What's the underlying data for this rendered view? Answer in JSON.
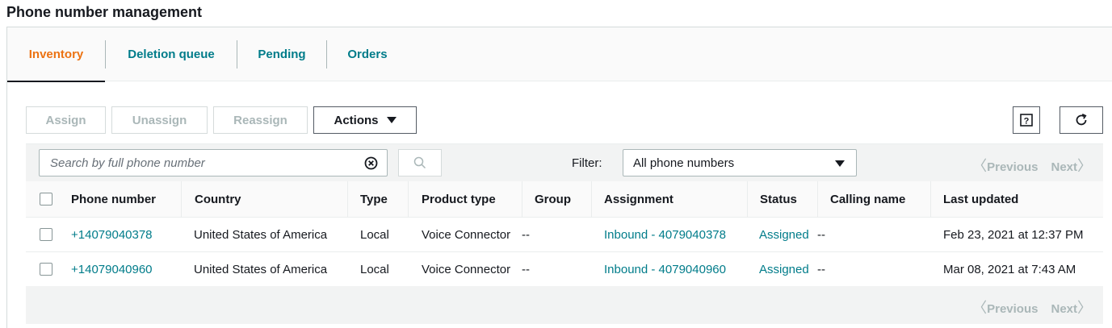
{
  "page": {
    "title": "Phone number management"
  },
  "tabs": [
    {
      "label": "Inventory",
      "active": true
    },
    {
      "label": "Deletion queue"
    },
    {
      "label": "Pending"
    },
    {
      "label": "Orders"
    }
  ],
  "actions": {
    "assign": "Assign",
    "unassign": "Unassign",
    "reassign": "Reassign",
    "actions": "Actions",
    "help_icon": "help-icon",
    "refresh_icon": "refresh-icon"
  },
  "search": {
    "placeholder": "Search by full phone number",
    "value": ""
  },
  "filter": {
    "label": "Filter:",
    "selected": "All phone numbers"
  },
  "pagination": {
    "previous": "Previous",
    "next": "Next"
  },
  "columns": [
    "Phone number",
    "Country",
    "Type",
    "Product type",
    "Group",
    "Assignment",
    "Status",
    "Calling name",
    "Last updated"
  ],
  "rows": [
    {
      "phone": "+14079040378",
      "country": "United States of America",
      "type": "Local",
      "product_type": "Voice Connector",
      "group": "--",
      "assignment": "Inbound - 4079040378",
      "status": "Assigned",
      "calling_name": "--",
      "last_updated": "Feb 23, 2021 at 12:37 PM"
    },
    {
      "phone": "+14079040960",
      "country": "United States of America",
      "type": "Local",
      "product_type": "Voice Connector",
      "group": "--",
      "assignment": "Inbound - 4079040960",
      "status": "Assigned",
      "calling_name": "--",
      "last_updated": "Mar 08, 2021 at 7:43 AM"
    }
  ],
  "colors": {
    "link": "#007c8a",
    "active_tab": "#ec7211",
    "disabled": "#aab7b8"
  }
}
